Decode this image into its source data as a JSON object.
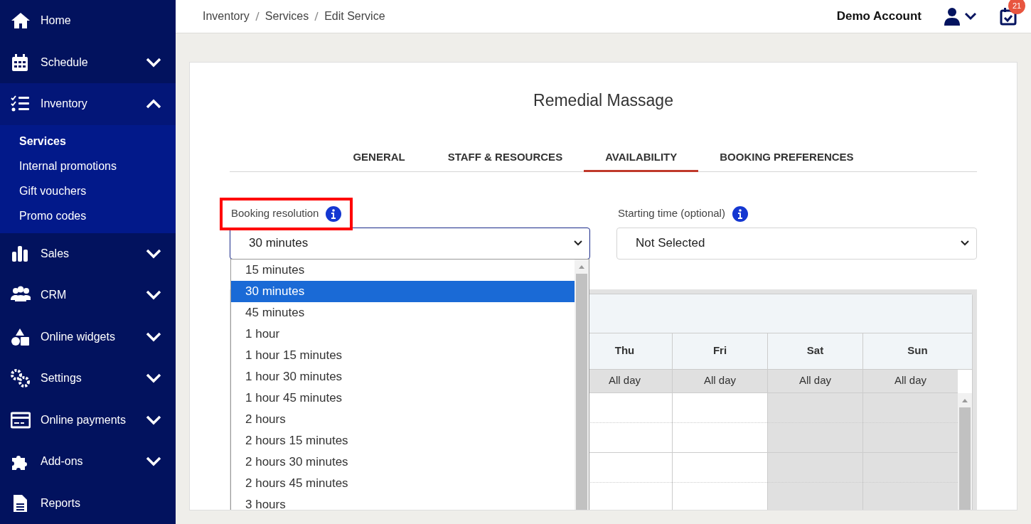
{
  "sidebar": {
    "items": [
      {
        "label": "Home",
        "expandable": false,
        "expanded": false
      },
      {
        "label": "Schedule",
        "expandable": true,
        "expanded": false
      },
      {
        "label": "Inventory",
        "expandable": true,
        "expanded": true,
        "children": [
          {
            "label": "Services",
            "selected": true
          },
          {
            "label": "Internal promotions",
            "selected": false
          },
          {
            "label": "Gift vouchers",
            "selected": false
          },
          {
            "label": "Promo codes",
            "selected": false
          }
        ]
      },
      {
        "label": "Sales",
        "expandable": true,
        "expanded": false
      },
      {
        "label": "CRM",
        "expandable": true,
        "expanded": false
      },
      {
        "label": "Online widgets",
        "expandable": true,
        "expanded": false
      },
      {
        "label": "Settings",
        "expandable": true,
        "expanded": false
      },
      {
        "label": "Online payments",
        "expandable": true,
        "expanded": false
      },
      {
        "label": "Add-ons",
        "expandable": true,
        "expanded": false
      },
      {
        "label": "Reports",
        "expandable": false,
        "expanded": false
      }
    ]
  },
  "breadcrumb": [
    "Inventory",
    "Services",
    "Edit Service"
  ],
  "header": {
    "account": "Demo Account",
    "notification_count": "21"
  },
  "service_title": "Remedial Massage",
  "tabs": [
    {
      "label": "GENERAL",
      "selected": false
    },
    {
      "label": "STAFF & RESOURCES",
      "selected": false
    },
    {
      "label": "AVAILABILITY",
      "selected": true
    },
    {
      "label": "BOOKING PREFERENCES",
      "selected": false
    }
  ],
  "fields": [
    {
      "label": "Booking resolution",
      "value": "30 minutes",
      "highlighted": true,
      "open": true,
      "options": [
        {
          "label": "15 minutes",
          "selected": false
        },
        {
          "label": "30 minutes",
          "selected": true
        },
        {
          "label": "45 minutes",
          "selected": false
        },
        {
          "label": "1 hour",
          "selected": false
        },
        {
          "label": "1 hour 15 minutes",
          "selected": false
        },
        {
          "label": "1 hour 30 minutes",
          "selected": false
        },
        {
          "label": "1 hour 45 minutes",
          "selected": false
        },
        {
          "label": "2 hours",
          "selected": false
        },
        {
          "label": "2 hours 15 minutes",
          "selected": false
        },
        {
          "label": "2 hours 30 minutes",
          "selected": false
        },
        {
          "label": "2 hours 45 minutes",
          "selected": false
        },
        {
          "label": "3 hours",
          "selected": false
        }
      ]
    },
    {
      "label": "Starting time (optional)",
      "value": "Not Selected",
      "highlighted": false,
      "open": false
    }
  ],
  "calendar": {
    "days": [
      {
        "name": "Thu",
        "all_day": "All day",
        "off": false
      },
      {
        "name": "Fri",
        "all_day": "All day",
        "off": false
      },
      {
        "name": "Sat",
        "all_day": "All day",
        "off": true
      },
      {
        "name": "Sun",
        "all_day": "All day",
        "off": true
      }
    ]
  }
}
